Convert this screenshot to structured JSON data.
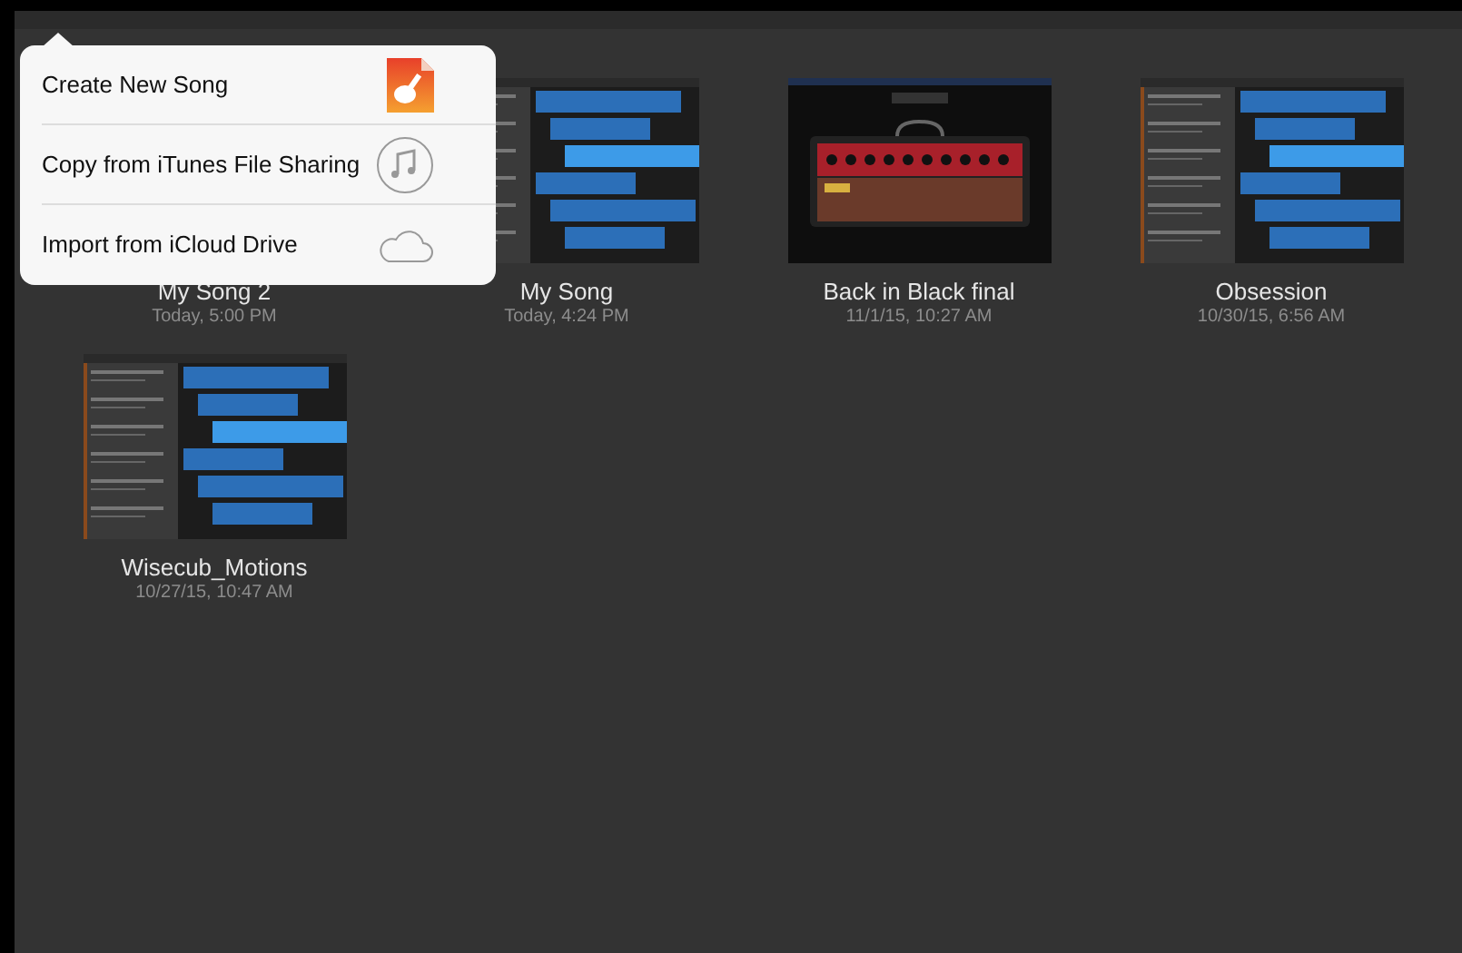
{
  "songs": [
    {
      "title": "My Song 2",
      "date": "Today, 5:00 PM",
      "kind": "covered"
    },
    {
      "title": "My Song",
      "date": "Today, 4:24 PM",
      "kind": "tracks"
    },
    {
      "title": "Back in Black final",
      "date": "11/1/15, 10:27 AM",
      "kind": "amp"
    },
    {
      "title": "Obsession",
      "date": "10/30/15, 6:56 AM",
      "kind": "tracks"
    },
    {
      "title": "Wisecub_Motions",
      "date": "10/27/15, 10:47 AM",
      "kind": "tracks"
    }
  ],
  "menu": [
    {
      "label": "Create New Song",
      "kind": "app"
    },
    {
      "label": "Copy from iTunes File Sharing",
      "kind": "music"
    },
    {
      "label": "Import from iCloud Drive",
      "kind": "cloud"
    }
  ]
}
